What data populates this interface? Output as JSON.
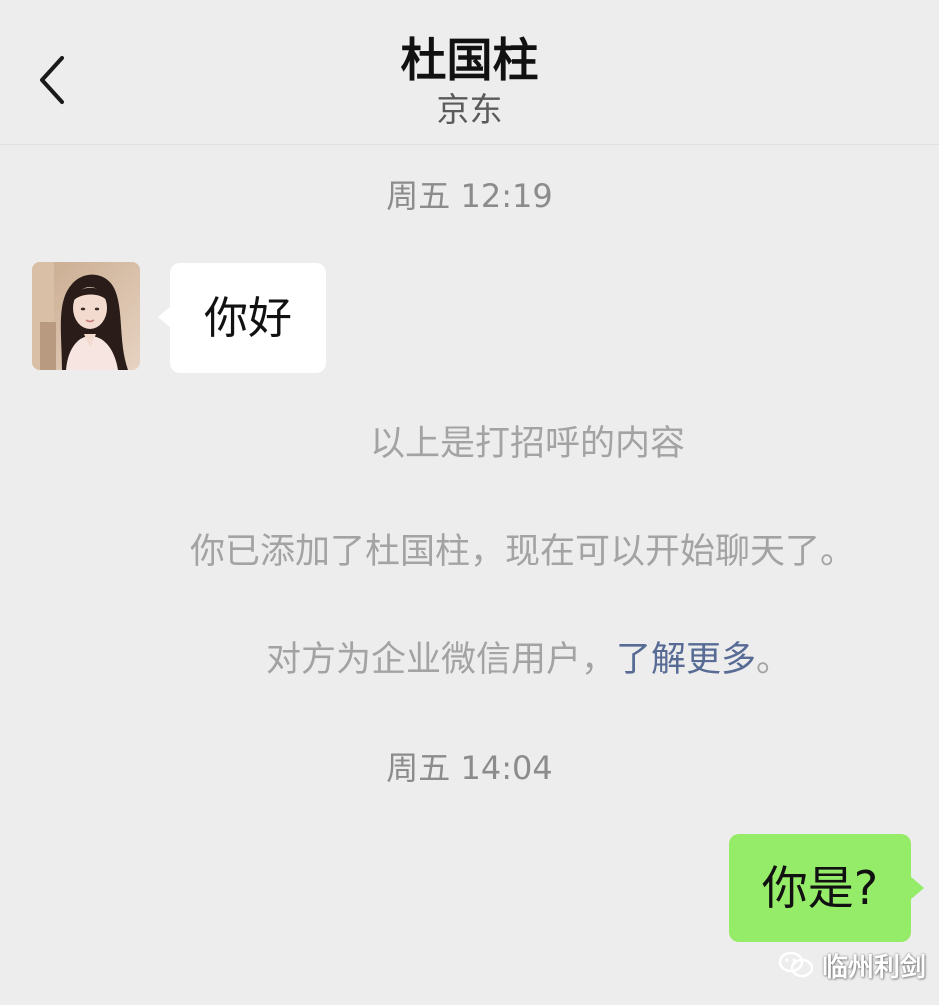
{
  "header": {
    "title": "杜国柱",
    "subtitle": "京东",
    "back_icon": "chevron-left-icon"
  },
  "chat": {
    "timestamp_1": "周五 12:19",
    "incoming_message": "你好",
    "system_line_1": "以上是打招呼的内容",
    "system_line_2": "你已添加了杜国柱，现在可以开始聊天了。",
    "system_line_3_prefix": "对方为企业微信用户，",
    "system_line_3_link": "了解更多",
    "system_line_3_suffix": "。",
    "timestamp_2": "周五 14:04",
    "outgoing_message": "你是?"
  },
  "watermark": {
    "icon": "wechat-icon",
    "text": "临州利剑"
  },
  "colors": {
    "background": "#ededed",
    "incoming_bubble": "#ffffff",
    "outgoing_bubble": "#95ec69",
    "link": "#576b95",
    "system_text": "#a3a3a3"
  }
}
